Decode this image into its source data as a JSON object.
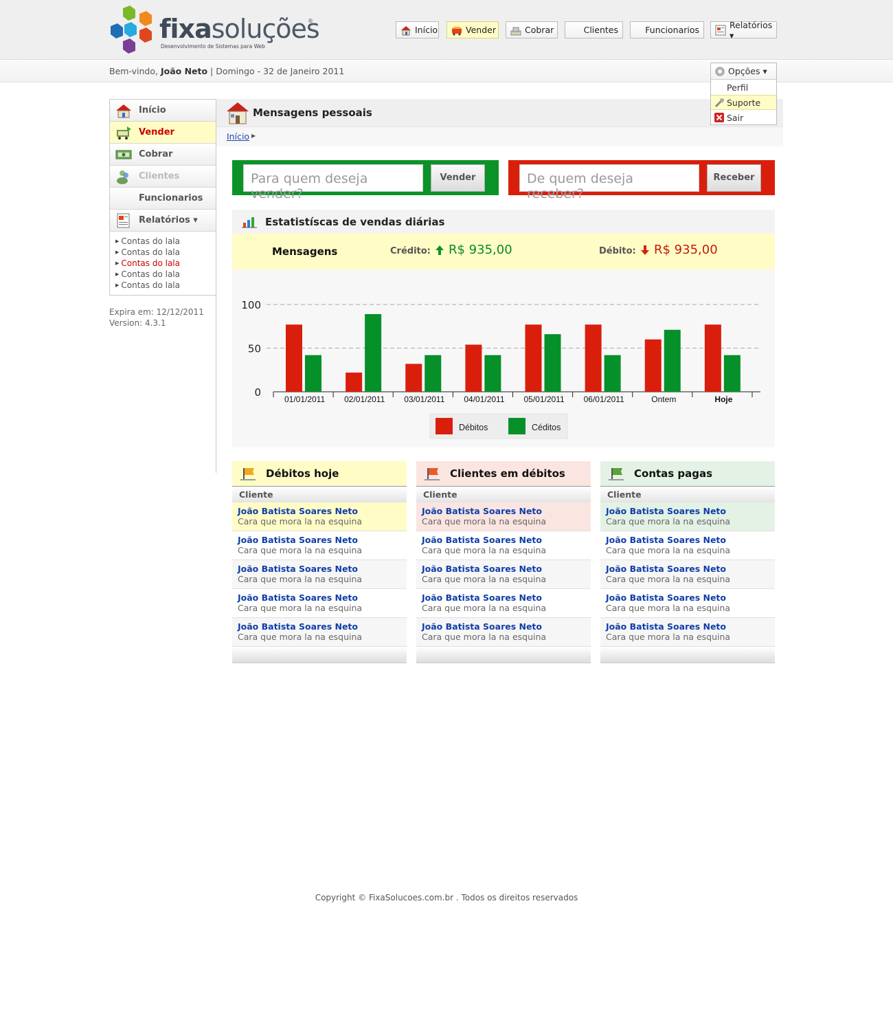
{
  "brand": {
    "name_bold": "fixa",
    "name_rest": "soluções",
    "tagline": "Desenvolvimento de Sistemas para Web",
    "registered": "®"
  },
  "topnav": [
    {
      "label": "Início",
      "icon": "home-icon"
    },
    {
      "label": "Vender",
      "icon": "cart-icon"
    },
    {
      "label": "Cobrar",
      "icon": "cash-icon"
    },
    {
      "label": "Clientes",
      "icon": ""
    },
    {
      "label": "Funcionarios",
      "icon": ""
    },
    {
      "label": "Relatórios ▾",
      "icon": "report-icon"
    }
  ],
  "welcome": {
    "prefix": "Bem-vindo, ",
    "user": "João Neto",
    "date": " | Domingo - 32 de Janeiro 2011"
  },
  "options_menu": {
    "title": "Opções ▾",
    "items": [
      "Perfil",
      "Suporte",
      "Sair"
    ]
  },
  "sidebar": {
    "items": [
      "Início",
      "Vender",
      "Cobrar",
      "Clientes",
      "Funcionarios",
      "Relatórios ▾"
    ],
    "sub_items": [
      "Contas do lala",
      "Contas do lala",
      "Contas do lala",
      "Contas do lala",
      "Contas do lala"
    ],
    "expires": "Expira em: 12/12/2011",
    "version": "Version: 4.3.1"
  },
  "page": {
    "title": "Mensagens pessoais",
    "breadcrumb": "Início"
  },
  "sell_box": {
    "placeholder": "Para quem deseja vender?",
    "button": "Vender"
  },
  "receive_box": {
    "placeholder": "De quem deseja receber?",
    "button": "Receber"
  },
  "stats": {
    "title": "Estatistíscas de vendas diárias",
    "summary_title": "Mensagens",
    "credit_label": "Crédito:",
    "credit_value": "R$ 935,00",
    "debit_label": "Débito:",
    "debit_value": "R$ 935,00"
  },
  "chart_data": {
    "type": "bar",
    "categories": [
      "01/01/2011",
      "02/01/2011",
      "03/01/2011",
      "04/01/2011",
      "05/01/2011",
      "06/01/2011",
      "Ontem",
      "Hoje"
    ],
    "series": [
      {
        "name": "Débitos",
        "color": "#d91f0c",
        "values": [
          77,
          22,
          32,
          54,
          77,
          77,
          60,
          77
        ]
      },
      {
        "name": "Céditos",
        "color": "#06902a",
        "values": [
          42,
          89,
          42,
          42,
          66,
          42,
          71,
          42
        ]
      }
    ],
    "y_ticks": [
      "0",
      "50",
      "100"
    ],
    "ylim": [
      0,
      100
    ],
    "grid": "dashed at 50 and 100",
    "legend": "bottom-center"
  },
  "panels": [
    {
      "title": "Débitos hoje",
      "column": "Cliente",
      "bg": "#fffcc6",
      "rows": [
        {
          "name": "João Batista Soares Neto",
          "desc": "Cara que mora la na esquina"
        },
        {
          "name": "João Batista Soares Neto",
          "desc": "Cara que mora la na esquina"
        },
        {
          "name": "João Batista Soares Neto",
          "desc": "Cara que mora la na esquina"
        },
        {
          "name": "João Batista Soares Neto",
          "desc": "Cara que mora la na esquina"
        },
        {
          "name": "João Batista Soares Neto",
          "desc": "Cara que mora la na esquina"
        }
      ]
    },
    {
      "title": "Clientes em débitos",
      "column": "Cliente",
      "bg": "#fbe5e1",
      "rows": [
        {
          "name": "João Batista Soares Neto",
          "desc": "Cara que mora la na esquina"
        },
        {
          "name": "João Batista Soares Neto",
          "desc": "Cara que mora la na esquina"
        },
        {
          "name": "João Batista Soares Neto",
          "desc": "Cara que mora la na esquina"
        },
        {
          "name": "João Batista Soares Neto",
          "desc": "Cara que mora la na esquina"
        },
        {
          "name": "João Batista Soares Neto",
          "desc": "Cara que mora la na esquina"
        }
      ]
    },
    {
      "title": "Contas pagas",
      "column": "Cliente",
      "bg": "#e3f2e5",
      "rows": [
        {
          "name": "João Batista Soares Neto",
          "desc": "Cara que mora la na esquina"
        },
        {
          "name": "João Batista Soares Neto",
          "desc": "Cara que mora la na esquina"
        },
        {
          "name": "João Batista Soares Neto",
          "desc": "Cara que mora la na esquina"
        },
        {
          "name": "João Batista Soares Neto",
          "desc": "Cara que mora la na esquina"
        },
        {
          "name": "João Batista Soares Neto",
          "desc": "Cara que mora la na esquina"
        }
      ]
    }
  ],
  "footer": "Copyright © FixaSolucoes.com.br . Todos os direitos reservados"
}
